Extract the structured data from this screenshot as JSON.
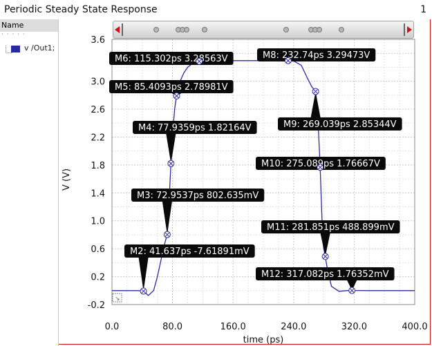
{
  "window": {
    "title": "Periodic Steady State Response",
    "page_number": "1"
  },
  "legend": {
    "header": "Name",
    "items": [
      {
        "label": "v /Out1;",
        "color": "#2a2aa0"
      }
    ]
  },
  "chart_data": {
    "type": "line",
    "title": "",
    "xlabel": "time (ps)",
    "ylabel": "V (V)",
    "xlim": [
      0.0,
      400.0
    ],
    "ylim": [
      -0.2,
      3.6
    ],
    "x_ticks": [
      "0.0",
      "80.0",
      "160.0",
      "240.0",
      "320.0",
      "400.0"
    ],
    "y_ticks": [
      "-0.2",
      "0.2",
      "0.6",
      "1.0",
      "1.4",
      "1.8",
      "2.2",
      "2.6",
      "3.0",
      "3.6"
    ],
    "grid": true,
    "series": [
      {
        "name": "v /Out1;",
        "color": "#2a2aa0",
        "x": [
          0,
          20,
          35,
          41.637,
          48,
          55,
          60,
          65,
          69,
          72.9537,
          75.5,
          77.9359,
          80.5,
          83,
          85.4093,
          90,
          95,
          100,
          107,
          115.302,
          135,
          160,
          200,
          232.74,
          240,
          250,
          258,
          264,
          269.039,
          272,
          275.089,
          277.5,
          279.5,
          281.851,
          285,
          290,
          300,
          310,
          317.082,
          340,
          370,
          400
        ],
        "y": [
          0.0,
          0.0,
          0.0,
          -0.0076,
          -0.07,
          0.0,
          0.2,
          0.45,
          0.65,
          0.8026,
          1.3,
          1.8216,
          2.3,
          2.62,
          2.7898,
          3.0,
          3.12,
          3.2,
          3.26,
          3.2856,
          3.295,
          3.295,
          3.295,
          3.2947,
          3.29,
          3.23,
          3.05,
          2.92,
          2.8534,
          2.5,
          1.7667,
          1.0,
          0.62,
          0.4889,
          0.28,
          0.06,
          -0.01,
          0.0,
          0.0018,
          0.0,
          0.0,
          0.0
        ]
      }
    ],
    "markers": [
      {
        "label": "M2: 41.637ps -7.61891mV",
        "x": 41.637,
        "y": -0.0076
      },
      {
        "label": "M3: 72.9537ps 802.635mV",
        "x": 72.9537,
        "y": 0.8026
      },
      {
        "label": "M4: 77.9359ps 1.82164V",
        "x": 77.9359,
        "y": 1.8216
      },
      {
        "label": "M5: 85.4093ps 2.78981V",
        "x": 85.4093,
        "y": 2.7898
      },
      {
        "label": "M6: 115.302ps 3.28563V",
        "x": 115.302,
        "y": 3.2856
      },
      {
        "label": "M8: 232.74ps 3.29473V",
        "x": 232.74,
        "y": 3.2947
      },
      {
        "label": "M9: 269.039ps 2.85344V",
        "x": 269.039,
        "y": 2.8534
      },
      {
        "label": "M10: 275.089ps 1.76667V",
        "x": 275.089,
        "y": 1.7667
      },
      {
        "label": "M11: 281.851ps 488.899mV",
        "x": 281.851,
        "y": 0.4889
      },
      {
        "label": "M12: 317.082ps 1.76352mV",
        "x": 317.082,
        "y": 0.0018
      }
    ]
  }
}
